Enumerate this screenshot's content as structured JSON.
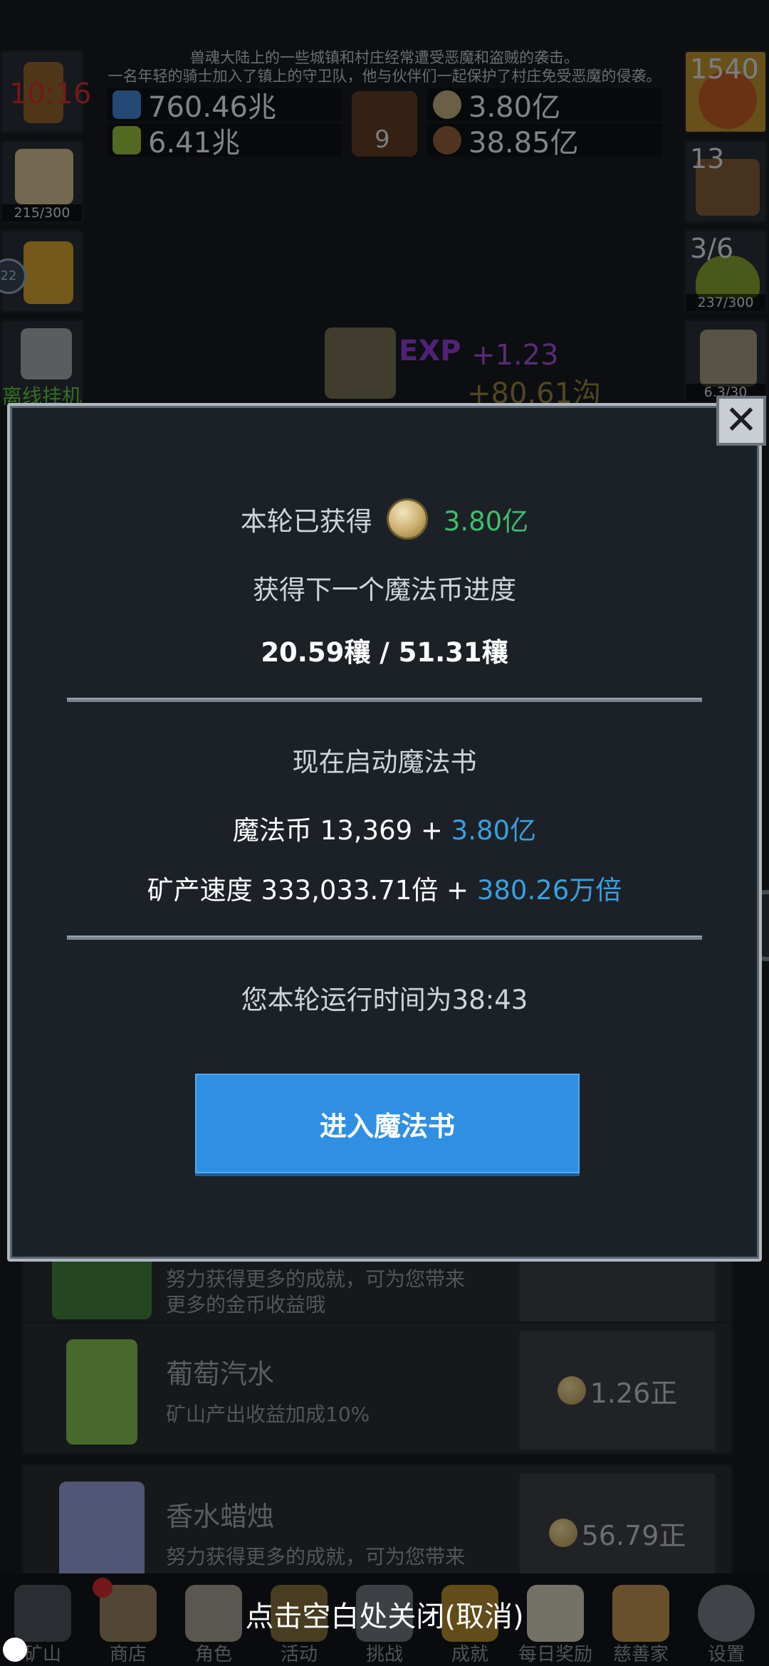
{
  "status": {
    "time": "10:16"
  },
  "story": {
    "line1": "兽魂大陆上的一些城镇和村庄经常遭受恶魔和盗贼的袭击。",
    "line2": "一名年轻的骑士加入了镇上的守卫队，他与伙伴们一起保护了村庄免受恶魔的侵袭。"
  },
  "resources": {
    "blue_potion": "760.46兆",
    "green_potion": "6.41兆",
    "book_count": "9",
    "coin_total": "3.80亿",
    "nut_total": "38.85亿"
  },
  "side_left": {
    "slot2_sub": "215/300",
    "slot3_badge": "22",
    "offline_label": "离线挂机"
  },
  "side_right": {
    "slot1_count": "1540",
    "slot2_count": "13",
    "slot3_count": "3/6",
    "slot3_sub": "237/300",
    "slot4_sub": "6.3/30"
  },
  "floating": {
    "exp_label": "EXP",
    "exp_gain": "+1.23",
    "gold_gain": "+80.61沟"
  },
  "modal": {
    "earned_label": "本轮已获得",
    "earned_value": "3.80亿",
    "progress_label": "获得下一个魔法币进度",
    "progress_value": "20.59穰 / 51.31穰",
    "start_label": "现在启动魔法书",
    "coin_label": "魔法币 13,369 + ",
    "coin_gain": "3.80亿",
    "speed_label": "矿产速度 333,033.71倍 + ",
    "speed_gain": "380.26万倍",
    "runtime": "您本轮运行时间为38:43",
    "enter_button": "进入魔法书",
    "colors": {
      "accent_green": "#3fbf6c",
      "accent_blue": "#3aa0dd",
      "button": "#2e8fe3"
    }
  },
  "shop": {
    "item0_desc1": "努力获得更多的成就，可为您带来",
    "item0_desc2": "更多的金币收益哦",
    "item1_name": "葡萄汽水",
    "item1_desc": "矿山产出收益加成10%",
    "item1_price": "1.26正",
    "item2_name": "香水蜡烛",
    "item2_desc": "努力获得更多的成就，可为您带来",
    "item2_price": "56.79正"
  },
  "close_hint": "点击空白处关闭(取消)",
  "bottom_nav": [
    {
      "label": "矿山",
      "icon": "lantern-icon"
    },
    {
      "label": "商店",
      "icon": "shop-icon"
    },
    {
      "label": "角色",
      "icon": "skull-icon"
    },
    {
      "label": "活动",
      "icon": "activity-icon"
    },
    {
      "label": "挑战",
      "icon": "challenge-icon"
    },
    {
      "label": "成就",
      "icon": "achievement-icon"
    },
    {
      "label": "每日奖励",
      "icon": "mail-icon"
    },
    {
      "label": "慈善家",
      "icon": "bread-icon"
    },
    {
      "label": "设置",
      "icon": "gear-icon"
    }
  ]
}
